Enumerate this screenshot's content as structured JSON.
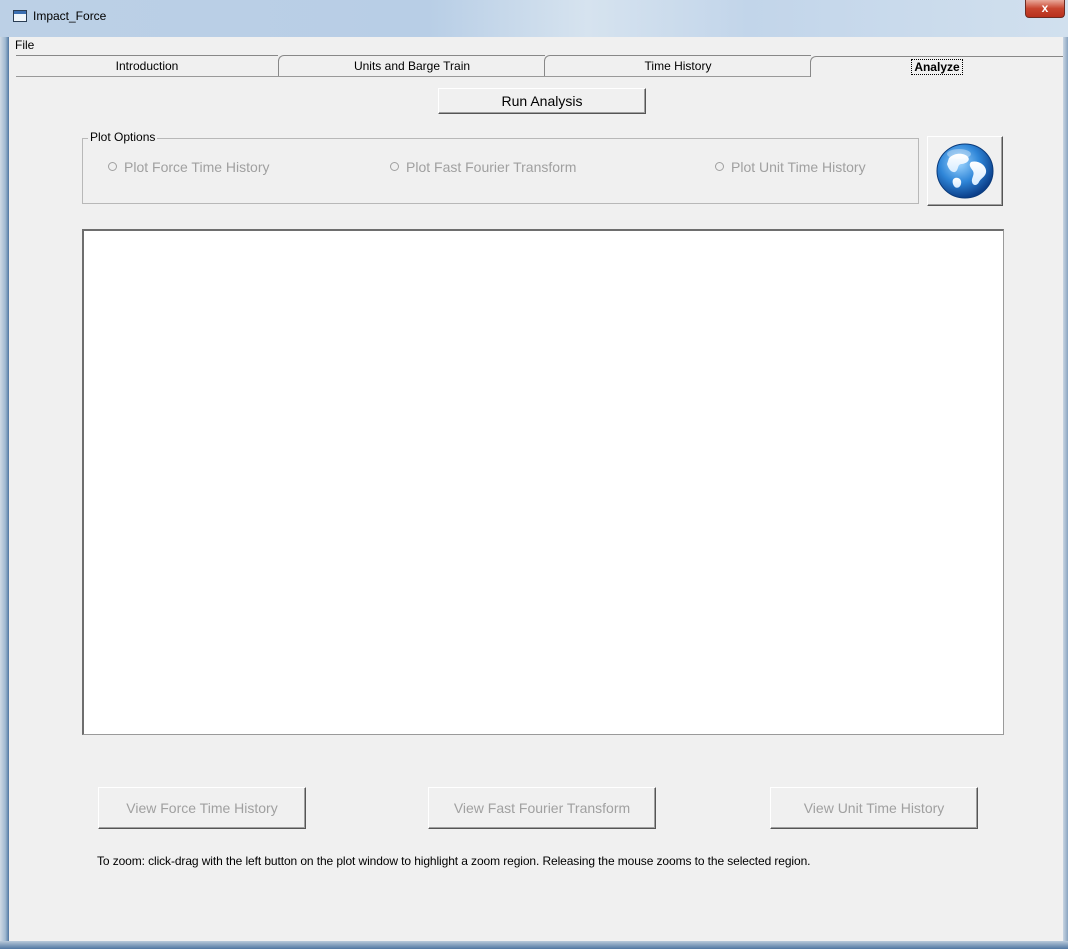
{
  "window": {
    "title": "Impact_Force",
    "close_glyph": "x"
  },
  "menu": {
    "items": [
      "File"
    ]
  },
  "tabs": [
    "Introduction",
    "Units and Barge Train",
    "Time History",
    "Analyze"
  ],
  "active_tab": "Analyze",
  "toolbar": {
    "run_label": "Run Analysis"
  },
  "plot_options": {
    "legend": "Plot Options",
    "radios": [
      "Plot Force Time History",
      "Plot Fast Fourier Transform",
      "Plot Unit Time History"
    ],
    "globe_icon": "globe-icon"
  },
  "buttons": {
    "view_force": "View Force Time History",
    "view_fft": "View Fast Fourier Transform",
    "view_unit": "View Unit Time History"
  },
  "note": "To zoom:  click-drag with the left button on the plot window to highlight a zoom region.  Releasing the mouse zooms to the selected region.",
  "colors": {
    "disabled_text": "#a0a0a0",
    "titlebar": "#b8cee6",
    "face": "#f0f0f0"
  }
}
